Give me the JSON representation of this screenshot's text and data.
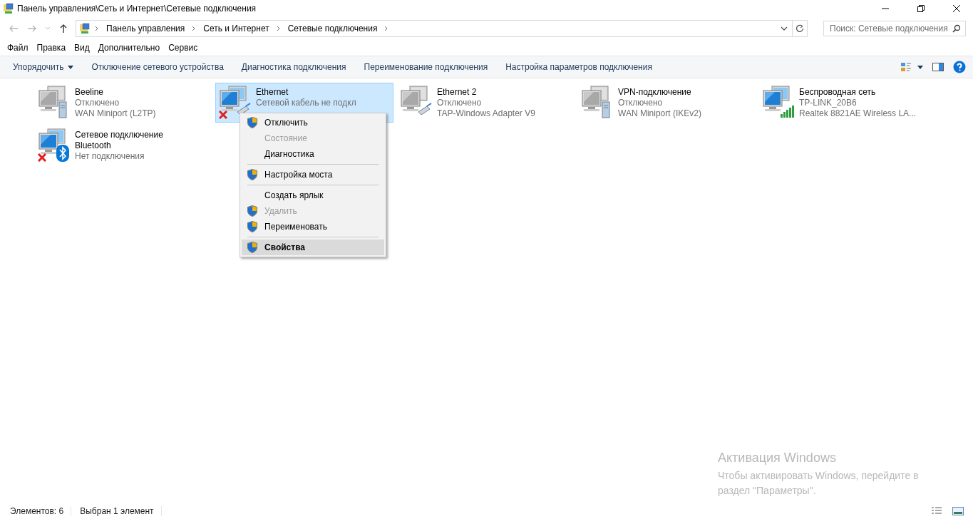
{
  "window": {
    "title": "Панель управления\\Сеть и Интернет\\Сетевые подключения"
  },
  "address_bar": {
    "breadcrumbs": [
      "Панель управления",
      "Сеть и Интернет",
      "Сетевые подключения"
    ]
  },
  "search": {
    "placeholder": "Поиск: Сетевые подключения"
  },
  "menu_bar": [
    "Файл",
    "Правка",
    "Вид",
    "Дополнительно",
    "Сервис"
  ],
  "command_bar": [
    {
      "label": "Упорядочить",
      "dropdown": true
    },
    {
      "label": "Отключение сетевого устройства",
      "dropdown": false
    },
    {
      "label": "Диагностика подключения",
      "dropdown": false
    },
    {
      "label": "Переименование подключения",
      "dropdown": false
    },
    {
      "label": "Настройка параметров подключения",
      "dropdown": false
    }
  ],
  "connections": [
    {
      "name": "Beeline",
      "status": "Отключено",
      "device": "WAN Miniport (L2TP)",
      "kind": "server",
      "active": false,
      "error": false,
      "selected": false
    },
    {
      "name": "Ethernet",
      "status": "Сетевой кабель не подкл",
      "kind": "cable",
      "active": true,
      "error": true,
      "selected": true
    },
    {
      "name": "Ethernet 2",
      "status": "Отключено",
      "device": "TAP-Windows Adapter V9",
      "kind": "cable",
      "active": false,
      "error": false,
      "selected": false
    },
    {
      "name": "VPN-подключение",
      "status": "Отключено",
      "device": "WAN Miniport (IKEv2)",
      "kind": "server",
      "active": false,
      "error": false,
      "selected": false
    },
    {
      "name": "Беспроводная сеть",
      "status": "TP-LINK_20B6",
      "device": "Realtek 8821AE Wireless LA...",
      "kind": "signal",
      "active": true,
      "error": false,
      "selected": false
    },
    {
      "name": "Сетевое подключение Bluetooth",
      "status": "Нет подключения",
      "kind": "bluetooth",
      "active": true,
      "error": true,
      "selected": false
    }
  ],
  "context_menu": [
    {
      "kind": "item",
      "label": "Отключить",
      "shield": true,
      "disabled": false,
      "default": false,
      "selected": false
    },
    {
      "kind": "item",
      "label": "Состояние",
      "shield": false,
      "disabled": true,
      "default": false,
      "selected": false
    },
    {
      "kind": "item",
      "label": "Диагностика",
      "shield": false,
      "disabled": false,
      "default": false,
      "selected": false
    },
    {
      "kind": "separator"
    },
    {
      "kind": "item",
      "label": "Настройка моста",
      "shield": true,
      "disabled": false,
      "default": false,
      "selected": false
    },
    {
      "kind": "separator"
    },
    {
      "kind": "item",
      "label": "Создать ярлык",
      "shield": false,
      "disabled": false,
      "default": false,
      "selected": false
    },
    {
      "kind": "item",
      "label": "Удалить",
      "shield": true,
      "disabled": true,
      "default": false,
      "selected": false
    },
    {
      "kind": "item",
      "label": "Переименовать",
      "shield": true,
      "disabled": false,
      "default": false,
      "selected": false
    },
    {
      "kind": "separator"
    },
    {
      "kind": "item",
      "label": "Свойства",
      "shield": true,
      "disabled": false,
      "default": true,
      "selected": true
    }
  ],
  "activation": {
    "title": "Активация Windows",
    "text": "Чтобы активировать Windows, перейдите в раздел \"Параметры\"."
  },
  "status_bar": [
    "Элементов: 6",
    "Выбран 1 элемент"
  ]
}
